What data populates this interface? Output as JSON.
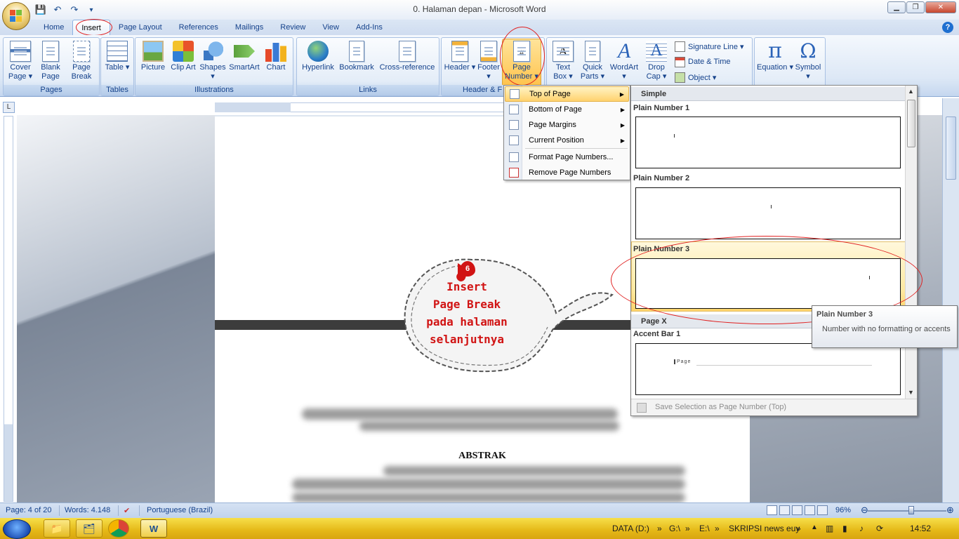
{
  "window": {
    "title": "0. Halaman depan - Microsoft Word",
    "help_label": "?"
  },
  "qat": {
    "save": "💾",
    "undo": "↶",
    "redo": "↷",
    "more": "▾"
  },
  "tabs": [
    "Home",
    "Insert",
    "Page Layout",
    "References",
    "Mailings",
    "Review",
    "View",
    "Add-Ins"
  ],
  "ribbon": {
    "groups": {
      "pages": "Pages",
      "tables": "Tables",
      "illustrations": "Illustrations",
      "links": "Links",
      "header_footer": "Header & F",
      "text": "",
      "symbols": ""
    },
    "buttons": {
      "cover_page": "Cover Page ▾",
      "blank_page": "Blank Page",
      "page_break": "Page Break",
      "table": "Table ▾",
      "picture": "Picture",
      "clip_art": "Clip Art",
      "shapes": "Shapes ▾",
      "smartart": "SmartArt",
      "chart": "Chart",
      "hyperlink": "Hyperlink",
      "bookmark": "Bookmark",
      "cross_reference": "Cross-reference",
      "header": "Header ▾",
      "footer": "Footer ▾",
      "page_number": "Page Number ▾",
      "text_box": "Text Box ▾",
      "quick_parts": "Quick Parts ▾",
      "wordart": "WordArt ▾",
      "drop_cap": "Drop Cap ▾",
      "signature_line": "Signature Line ▾",
      "date_time": "Date & Time",
      "object": "Object ▾",
      "equation": "Equation ▾",
      "symbol": "Symbol ▾"
    }
  },
  "page_number_menu": {
    "items": [
      {
        "label": "Top of Page",
        "submenu": true
      },
      {
        "label": "Bottom of Page",
        "submenu": true
      },
      {
        "label": "Page Margins",
        "submenu": true
      },
      {
        "label": "Current Position",
        "submenu": true
      },
      {
        "label": "Format Page Numbers...",
        "submenu": false
      },
      {
        "label": "Remove Page Numbers",
        "submenu": false
      }
    ]
  },
  "gallery": {
    "section_simple": "Simple",
    "section_pagex": "Page X",
    "items": [
      "Plain Number 1",
      "Plain Number 2",
      "Plain Number 3",
      "Accent Bar 1"
    ],
    "accent_preview_text": "Page",
    "footer": "Save Selection as Page Number (Top)"
  },
  "tooltip": {
    "title": "Plain Number 3",
    "body": "Number with no formatting or accents"
  },
  "callout": {
    "number": "6",
    "lines": [
      "Insert",
      "Page Break",
      "pada halaman",
      "selanjutnya"
    ]
  },
  "document": {
    "heading": "ABSTRAK"
  },
  "status": {
    "page": "Page: 4 of 20",
    "words": "Words: 4.148",
    "language": "Portuguese (Brazil)",
    "zoom": "96%",
    "zoom_fraction": 0.55
  },
  "taskbar": {
    "tray": [
      "DATA (D:)",
      "G:\\",
      "E:\\",
      "SKRIPSI news euy"
    ],
    "clock": "14:52"
  },
  "colors": {
    "accent": "#15428b",
    "annotation_red": "#e02020",
    "taskbar": "#e5b817"
  }
}
